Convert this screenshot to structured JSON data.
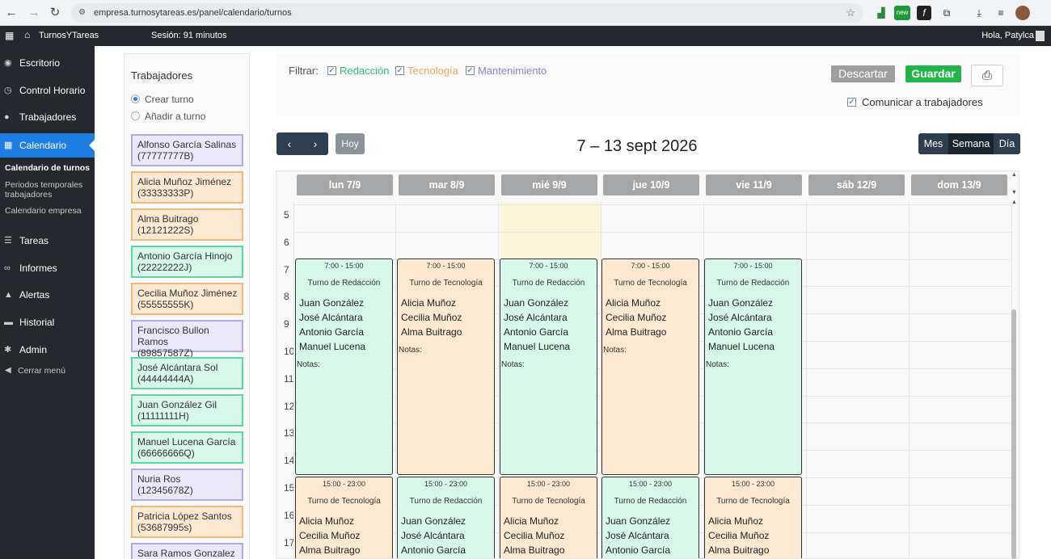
{
  "browser": {
    "url": "empresa.turnosytareas.es/panel/calendario/turnos",
    "extensions": [
      "chart-ext-icon",
      "new-badge-icon",
      "formula-ext-icon",
      "puzzle-icon",
      "download-icon",
      "playlist-icon",
      "profile-avatar"
    ],
    "new_badge": "new"
  },
  "topbar": {
    "brand": "TurnosYTareas",
    "session": "Sesión: 91 minutos",
    "greeting": "Hola, Patylca"
  },
  "sidebar": {
    "items": [
      {
        "label": "Escritorio",
        "icon": "dashboard-icon"
      },
      {
        "label": "Control Horario",
        "icon": "clock-icon"
      },
      {
        "label": "Trabajadores",
        "icon": "user-icon"
      },
      {
        "label": "Calendario",
        "icon": "calendar-icon",
        "active": true
      },
      {
        "label": "Tareas",
        "icon": "tasks-icon"
      },
      {
        "label": "Informes",
        "icon": "link-icon"
      },
      {
        "label": "Alertas",
        "icon": "bell-icon"
      },
      {
        "label": "Historial",
        "icon": "folder-icon"
      },
      {
        "label": "Admin",
        "icon": "gear-icon"
      }
    ],
    "subitems": [
      "Calendario de turnos",
      "Periodos temporales trabajadores",
      "Calendario empresa"
    ],
    "close_menu": "Cerrar menú"
  },
  "workers_panel": {
    "title": "Trabajadores",
    "mode_options": [
      "Crear turno",
      "Añadir a turno"
    ],
    "selected_mode": "Crear turno",
    "workers": [
      {
        "name": "Alfonso García Salinas",
        "id": "(77777777B)",
        "type": "man"
      },
      {
        "name": "Alicia Muñoz Jiménez",
        "id": "(33333333P)",
        "type": "tec"
      },
      {
        "name": "Alma Buitrago",
        "id": "(12121222S)",
        "type": "tec"
      },
      {
        "name": "Antonio García Hinojo",
        "id": "(22222222J)",
        "type": "red"
      },
      {
        "name": "Cecilia Muñoz Jiménez",
        "id": "(55555555K)",
        "type": "tec"
      },
      {
        "name": "Francisco Bullon Ramos",
        "id": "(89857587Z)",
        "type": "man"
      },
      {
        "name": "José Alcántara Sol",
        "id": "(44444444A)",
        "type": "red"
      },
      {
        "name": "Juan González Gil",
        "id": "(11111111H)",
        "type": "red"
      },
      {
        "name": "Manuel Lucena García",
        "id": "(66666666Q)",
        "type": "red"
      },
      {
        "name": "Nuria Ros",
        "id": "(12345678Z)",
        "type": "man"
      },
      {
        "name": "Patricia López Santos",
        "id": "(53687995s)",
        "type": "tec"
      },
      {
        "name": "Sara Ramos Gonzalez",
        "id": "",
        "type": "man"
      }
    ]
  },
  "filters": {
    "label": "Filtrar:",
    "options": [
      {
        "label": "Redacción",
        "color": "#2fbf7a",
        "checked": true
      },
      {
        "label": "Tecnología",
        "color": "#e8a85a",
        "checked": true
      },
      {
        "label": "Mantenimiento",
        "color": "#8a86c4",
        "checked": true
      }
    ],
    "check_glyph": "✓"
  },
  "actions": {
    "discard": "Descartar",
    "save": "Guardar",
    "print_icon": "printer-icon",
    "communicate": "Comunicar a trabajadores",
    "communicate_checked": true
  },
  "calendar": {
    "prev": "‹",
    "next": "›",
    "today": "Hoy",
    "period": "7 – 13 sept 2026",
    "views": [
      "Mes",
      "Semana",
      "Día"
    ],
    "active_view": "Semana",
    "days": [
      "lun 7/9",
      "mar 8/9",
      "mié 9/9",
      "jue 10/9",
      "vie 11/9",
      "sáb 12/9",
      "dom 13/9"
    ],
    "hours": [
      "5",
      "6",
      "7",
      "8",
      "9",
      "10",
      "11",
      "12",
      "13",
      "14",
      "15",
      "16",
      "17"
    ],
    "shifts": [
      {
        "day": 0,
        "slot": "morning",
        "time": "7:00 - 15:00",
        "name": "Turno de Redacción",
        "type": "red",
        "workers": [
          "Juan González",
          "José Alcántara",
          "Antonio García",
          "Manuel Lucena"
        ],
        "notes": "Notas:"
      },
      {
        "day": 1,
        "slot": "morning",
        "time": "7:00 - 15:00",
        "name": "Turno de Tecnología",
        "type": "tec",
        "workers": [
          "Alicia Muñoz",
          "Cecilia Muñoz",
          "Alma Buitrago"
        ],
        "notes": "Notas:"
      },
      {
        "day": 2,
        "slot": "morning",
        "time": "7:00 - 15:00",
        "name": "Turno de Redacción",
        "type": "red",
        "workers": [
          "Juan González",
          "José Alcántara",
          "Antonio García",
          "Manuel Lucena"
        ],
        "notes": "Notas:"
      },
      {
        "day": 3,
        "slot": "morning",
        "time": "7:00 - 15:00",
        "name": "Turno de Tecnología",
        "type": "tec",
        "workers": [
          "Alicia Muñoz",
          "Cecilia Muñoz",
          "Alma Buitrago"
        ],
        "notes": "Notas:"
      },
      {
        "day": 4,
        "slot": "morning",
        "time": "7:00 - 15:00",
        "name": "Turno de Redacción",
        "type": "red",
        "workers": [
          "Juan González",
          "José Alcántara",
          "Antonio García",
          "Manuel Lucena"
        ],
        "notes": "Notas:"
      },
      {
        "day": 0,
        "slot": "afternoon",
        "time": "15:00 - 23:00",
        "name": "Turno de Tecnología",
        "type": "tec",
        "workers": [
          "Alicia Muñoz",
          "Cecilia Muñoz",
          "Alma Buitrago"
        ],
        "notes": ""
      },
      {
        "day": 1,
        "slot": "afternoon",
        "time": "15:00 - 23:00",
        "name": "Turno de Redacción",
        "type": "red",
        "workers": [
          "Juan González",
          "José Alcántara",
          "Antonio García"
        ],
        "notes": ""
      },
      {
        "day": 2,
        "slot": "afternoon",
        "time": "15:00 - 23:00",
        "name": "Turno de Tecnología",
        "type": "tec",
        "workers": [
          "Alicia Muñoz",
          "Cecilia Muñoz",
          "Alma Buitrago"
        ],
        "notes": ""
      },
      {
        "day": 3,
        "slot": "afternoon",
        "time": "15:00 - 23:00",
        "name": "Turno de Redacción",
        "type": "red",
        "workers": [
          "Juan González",
          "José Alcántara",
          "Antonio García"
        ],
        "notes": ""
      },
      {
        "day": 4,
        "slot": "afternoon",
        "time": "15:00 - 23:00",
        "name": "Turno de Tecnología",
        "type": "tec",
        "workers": [
          "Alicia Muñoz",
          "Cecilia Muñoz",
          "Alma Buitrago"
        ],
        "notes": ""
      }
    ]
  }
}
